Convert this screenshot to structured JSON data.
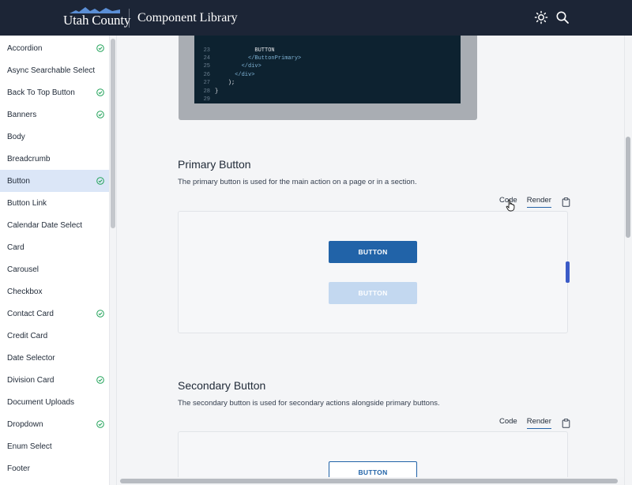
{
  "header": {
    "logo_text": "Utah County",
    "title": "Component Library",
    "icons": [
      "sun-icon",
      "search-icon"
    ]
  },
  "sidebar": {
    "items": [
      {
        "label": "Accordion",
        "checked": true
      },
      {
        "label": "Async Searchable Select",
        "checked": false
      },
      {
        "label": "Back To Top Button",
        "checked": true
      },
      {
        "label": "Banners",
        "checked": true
      },
      {
        "label": "Body",
        "checked": false
      },
      {
        "label": "Breadcrumb",
        "checked": false
      },
      {
        "label": "Button",
        "checked": true,
        "active": true
      },
      {
        "label": "Button Link",
        "checked": false
      },
      {
        "label": "Calendar Date Select",
        "checked": false
      },
      {
        "label": "Card",
        "checked": false
      },
      {
        "label": "Carousel",
        "checked": false
      },
      {
        "label": "Checkbox",
        "checked": false
      },
      {
        "label": "Contact Card",
        "checked": true
      },
      {
        "label": "Credit Card",
        "checked": false
      },
      {
        "label": "Date Selector",
        "checked": false
      },
      {
        "label": "Division Card",
        "checked": true
      },
      {
        "label": "Document Uploads",
        "checked": false
      },
      {
        "label": "Dropdown",
        "checked": true
      },
      {
        "label": "Enum Select",
        "checked": false
      },
      {
        "label": "Footer",
        "checked": false
      }
    ]
  },
  "code": {
    "lines": [
      {
        "n": "",
        "text": ""
      },
      {
        "n": "23",
        "text": "            BUTTON"
      },
      {
        "n": "24",
        "text": "          </ButtonPrimary>"
      },
      {
        "n": "25",
        "text": "        </div>"
      },
      {
        "n": "26",
        "text": "      </div>"
      },
      {
        "n": "27",
        "text": "    );"
      },
      {
        "n": "28",
        "text": "}"
      },
      {
        "n": "29",
        "text": ""
      }
    ]
  },
  "sections": {
    "primary": {
      "title": "Primary Button",
      "description": "The primary button is used for the main action on a page or in a section.",
      "tab_code": "Code",
      "tab_render": "Render",
      "button_label": "BUTTON",
      "button_disabled_label": "BUTTON"
    },
    "secondary": {
      "title": "Secondary Button",
      "description": "The secondary button is used for secondary actions alongside primary buttons.",
      "tab_code": "Code",
      "tab_render": "Render",
      "button_label": "BUTTON"
    }
  },
  "colors": {
    "header_bg": "#1c2536",
    "primary": "#2163a8",
    "primary_disabled": "#c3d8f0",
    "active_nav": "#dbe6f7",
    "check": "#22a35a"
  }
}
